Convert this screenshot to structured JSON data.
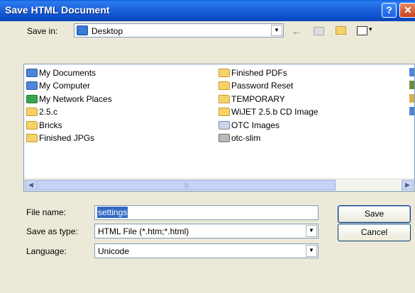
{
  "window": {
    "title": "Save HTML Document",
    "help_glyph": "?",
    "close_glyph": "✕"
  },
  "toolbar": {
    "save_in_label": "Save in:",
    "save_in_value": "Desktop",
    "back_icon": "back-arrow-icon",
    "up_icon": "up-folder-icon",
    "new_folder_icon": "new-folder-icon",
    "view_menu_icon": "view-menu-icon"
  },
  "files": {
    "column1": [
      {
        "name": "My Documents",
        "icon": "my-documents-icon"
      },
      {
        "name": "My Computer",
        "icon": "computer-icon"
      },
      {
        "name": "My Network Places",
        "icon": "network-icon"
      },
      {
        "name": "2.5.c",
        "icon": "folder-icon"
      },
      {
        "name": "Bricks",
        "icon": "folder-icon"
      },
      {
        "name": "Finished JPGs",
        "icon": "folder-icon"
      }
    ],
    "column2": [
      {
        "name": "Finished PDFs",
        "icon": "folder-icon"
      },
      {
        "name": "Password Reset",
        "icon": "folder-icon"
      },
      {
        "name": "TEMPORARY",
        "icon": "folder-icon"
      },
      {
        "name": "WiJET 2.5.b CD Image",
        "icon": "folder-icon"
      },
      {
        "name": "OTC Images",
        "icon": "shortcut-icon"
      },
      {
        "name": "otc-slim",
        "icon": "shortcut-icon"
      }
    ]
  },
  "form": {
    "file_name_label": "File name:",
    "file_name_value": "settings",
    "save_type_label": "Save as type:",
    "save_type_value": "HTML File (*.htm;*.html)",
    "language_label": "Language:",
    "language_value": "Unicode"
  },
  "buttons": {
    "save": "Save",
    "cancel": "Cancel"
  },
  "colors": {
    "titlebar": "#0a4dc6",
    "dialog_bg": "#ece9d8",
    "selection": "#316ac5"
  }
}
